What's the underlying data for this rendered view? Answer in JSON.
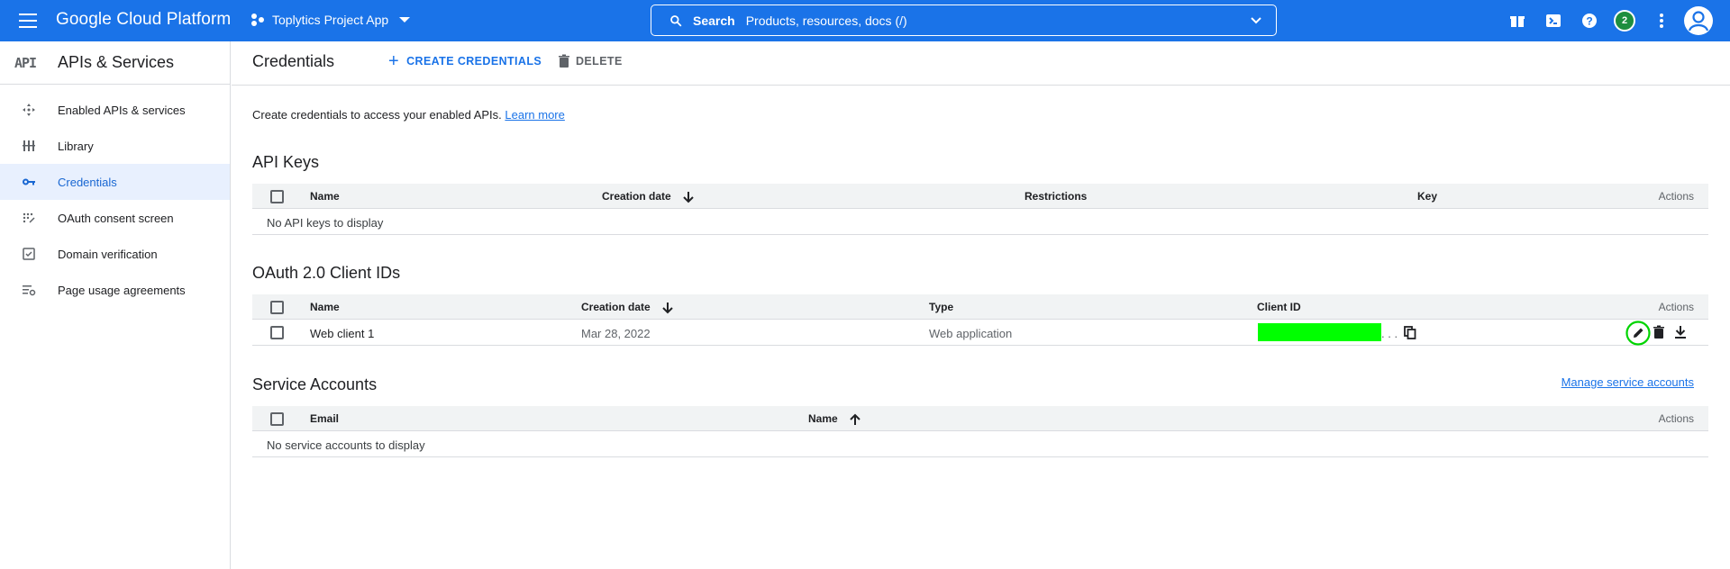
{
  "topbar": {
    "brand": "Google Cloud Platform",
    "project": "Toplytics Project App",
    "search_label": "Search",
    "search_placeholder": "Products, resources, docs (/)",
    "notification_count": "2",
    "accent": "#1a73e8"
  },
  "sidebar": {
    "api_logo": "API",
    "title": "APIs & Services",
    "items": [
      {
        "label": "Enabled APIs & services",
        "icon": "enabled-apis-icon"
      },
      {
        "label": "Library",
        "icon": "library-icon"
      },
      {
        "label": "Credentials",
        "icon": "key-icon",
        "active": true
      },
      {
        "label": "OAuth consent screen",
        "icon": "consent-icon"
      },
      {
        "label": "Domain verification",
        "icon": "checkbox-icon"
      },
      {
        "label": "Page usage agreements",
        "icon": "settings-list-icon"
      }
    ]
  },
  "main": {
    "title": "Credentials",
    "create_label": "CREATE CREDENTIALS",
    "delete_label": "DELETE",
    "intro": "Create credentials to access your enabled APIs.",
    "learn_more": "Learn more",
    "api_keys": {
      "title": "API Keys",
      "columns": [
        "Name",
        "Creation date",
        "Restrictions",
        "Key",
        "Actions"
      ],
      "empty": "No API keys to display"
    },
    "oauth": {
      "title": "OAuth 2.0 Client IDs",
      "columns": [
        "Name",
        "Creation date",
        "Type",
        "Client ID",
        "Actions"
      ],
      "rows": [
        {
          "name": "Web client 1",
          "date": "Mar 28, 2022",
          "type": "Web application",
          "client_id_suffix": ". . ."
        }
      ]
    },
    "service_accounts": {
      "title": "Service Accounts",
      "manage": "Manage service accounts",
      "columns": [
        "Email",
        "Name",
        "Actions"
      ],
      "empty": "No service accounts to display"
    }
  }
}
